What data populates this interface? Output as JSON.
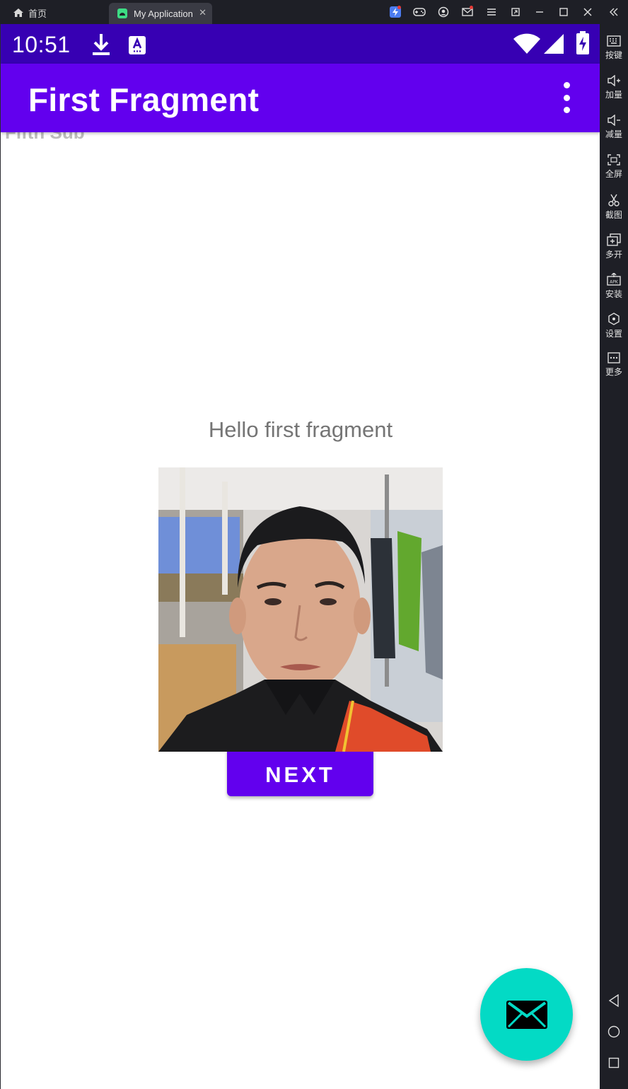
{
  "window": {
    "home_tab_label": "首页",
    "app_tab_label": "My Application",
    "tab_close": "✕"
  },
  "status_bar": {
    "time": "10:51",
    "background": "#3700b3"
  },
  "app_bar": {
    "title": "First Fragment",
    "background": "#6200ee"
  },
  "content": {
    "peek_text": "Fifth Sub",
    "hello_text": "Hello first fragment",
    "next_label": "NEXT",
    "fab_color": "#03dac5"
  },
  "sidebar": {
    "items": [
      {
        "label": "按键",
        "icon": "keyboard-icon"
      },
      {
        "label": "加量",
        "icon": "volume-up-icon"
      },
      {
        "label": "减量",
        "icon": "volume-down-icon"
      },
      {
        "label": "全屏",
        "icon": "fullscreen-icon"
      },
      {
        "label": "截图",
        "icon": "scissors-icon"
      },
      {
        "label": "多开",
        "icon": "multi-instance-icon"
      },
      {
        "label": "安装",
        "icon": "apk-install-icon"
      },
      {
        "label": "设置",
        "icon": "settings-icon"
      },
      {
        "label": "更多",
        "icon": "more-icon"
      }
    ]
  }
}
